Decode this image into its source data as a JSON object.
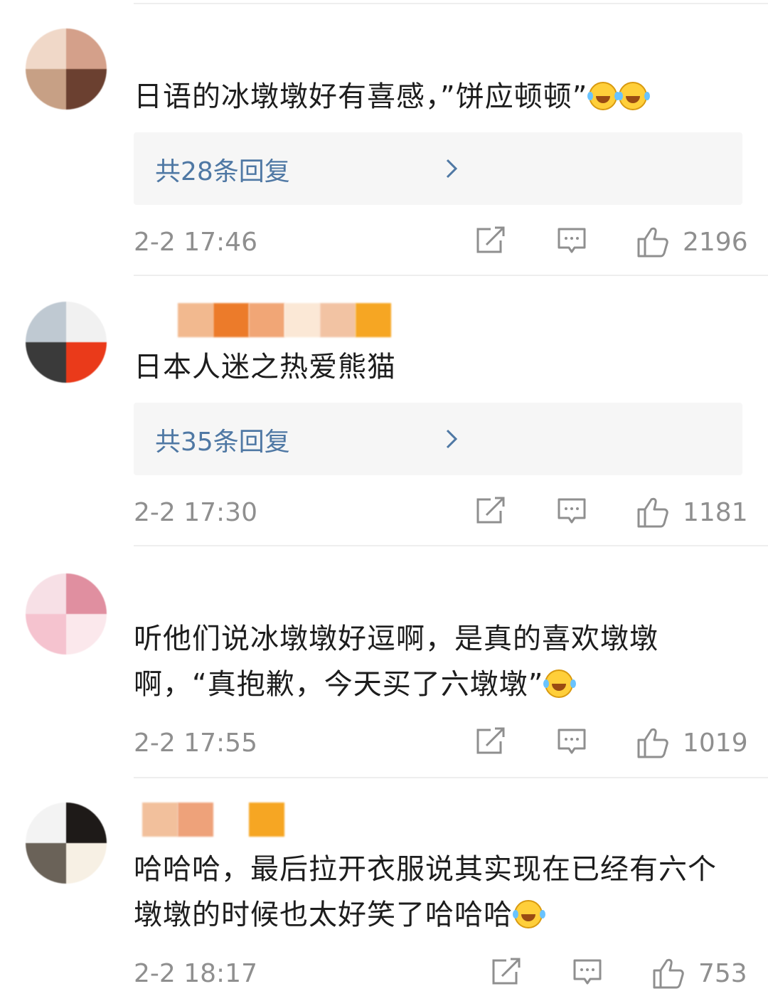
{
  "comments": [
    {
      "text": "日语的冰墩墩好有喜感，”饼应顿顿”",
      "emojis": [
        "laughing-crying",
        "laughing-crying"
      ],
      "reply_label": "共28条回复",
      "time": "2-2 17:46",
      "likes": "2196",
      "avatar_colors": [
        "#f0d8c8",
        "#d4a08a",
        "#c7a085",
        "#6b4030"
      ]
    },
    {
      "text": "日本人迷之热爱熊猫",
      "emojis": [],
      "reply_label": "共35条回复",
      "time": "2-2 17:30",
      "likes": "1181",
      "avatar_colors": [
        "#bfc9d2",
        "#f1f1f1",
        "#3a3a3a",
        "#ea3a1a"
      ]
    },
    {
      "text": "听他们说冰墩墩好逗啊，是真的喜欢墩墩啊，“真抱歉，今天买了六墩墩”",
      "emojis": [
        "laughing-crying"
      ],
      "reply_label": "",
      "time": "2-2 17:55",
      "likes": "1019",
      "avatar_colors": [
        "#f7e0e6",
        "#e08fa0",
        "#f5c3cf",
        "#fbe8ec"
      ]
    },
    {
      "text": "哈哈哈，最后拉开衣服说其实现在已经有六个墩墩的时候也太好笑了哈哈哈",
      "emojis": [
        "laughing-crying"
      ],
      "reply_label": "",
      "time": "2-2 18:17",
      "likes": "753",
      "avatar_colors": [
        "#f3f3f3",
        "#1e1a18",
        "#6a6258",
        "#f7f0e4"
      ]
    }
  ],
  "colors": {
    "reply_link": "#4f78a4",
    "meta_gray": "#8f8f8f",
    "reply_bg": "#f6f6f6"
  },
  "icons": [
    "share-icon",
    "comment-icon",
    "like-icon",
    "chevron-right-icon",
    "laughing-crying-emoji"
  ]
}
